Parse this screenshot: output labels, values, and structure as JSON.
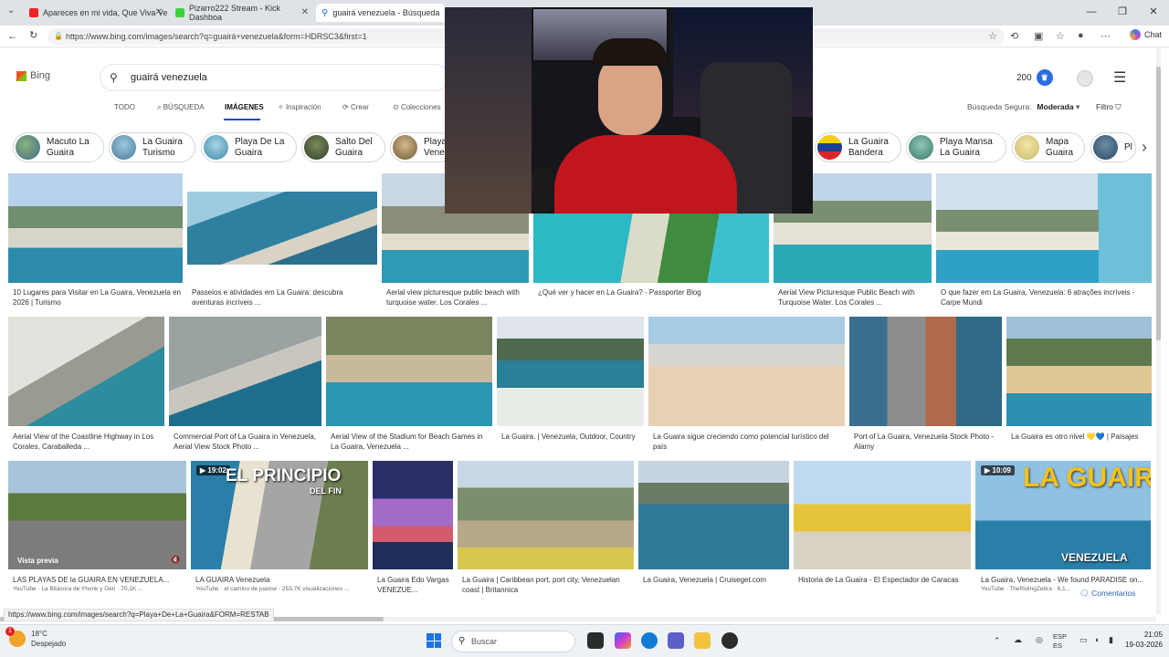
{
  "browser": {
    "tabs": [
      {
        "title": "Apareces en mi vida, Que Viva Ve",
        "color": "#e22"
      },
      {
        "title": "Pizarro222 Stream - Kick Dashboa",
        "color": "#3ad33a"
      },
      {
        "title": "guairá venezuela - Búsqueda",
        "color": "#2d6de0"
      }
    ],
    "url": "https://www.bing.com/images/search?q=guairá+venezuela&form=HDRSC3&first=1",
    "chat_label": "Chat",
    "status_url": "https://www.bing.com/images/search?q=Playa+De+La+Guaira&FORM=RESTAB"
  },
  "bing": {
    "logo_text": "Bing",
    "query": "guairá venezuela",
    "rewards_points": "200",
    "nav_tabs": [
      "TODO",
      "BÚSQUEDA",
      "IMÁGENES",
      "Inspiración",
      "Crear",
      "Colecciones"
    ],
    "safe_search_label": "Búsqueda Segura:",
    "safe_search_value": "Moderada",
    "filter_label": "Filtro",
    "chips": [
      "Macuto La\nGuaira",
      "La Guaira\nTurismo",
      "Playa De La\nGuaira",
      "Salto Del\nGuaira",
      "Playa\nVene",
      "La Guaira\nBandera",
      "Playa Mansa\nLa Guaira",
      "Mapa\nGuaira",
      "Pl"
    ],
    "feedback_label": "Comentarios"
  },
  "results": {
    "row1": [
      {
        "caption": "10 Lugares para Visitar en La Guaira, Venezuela en 2026 | Turismo"
      },
      {
        "caption": "Passeios e atividades em La Guaira: descubra aventuras incríveis ..."
      },
      {
        "caption": "Aerial view picturesque public beach with turquoise water. Los Corales ..."
      },
      {
        "caption": "¿Qué ver y hacer en La Guaira? - Passporter Blog"
      },
      {
        "caption": "Aerial View Picturesque Public Beach with Turquoise Water. Los Corales ..."
      },
      {
        "caption": "O que fazer em La Guaira, Venezuela: 6 atrações incríveis - Carpe Mundi"
      }
    ],
    "row2": [
      {
        "caption": "Aerial View of the Coastline Highway in Los Corales, Caraballeda ..."
      },
      {
        "caption": "Commercial Port of La Guaira in Venezuela, Aerial View Stock Photo ..."
      },
      {
        "caption": "Aerial View of the Stadium for Beach Games in La Guaira, Venezuela ..."
      },
      {
        "caption": "La Guaira. | Venezuela, Outdoor, Country"
      },
      {
        "caption": "La Guaira sigue creciendo como potencial turístico del país"
      },
      {
        "caption": "Port of La Guaira, Venezuela Stock Photo - Alamy"
      },
      {
        "caption": "La Guaira es otro nivel 💛💙 | Paisajes"
      }
    ],
    "row3": [
      {
        "caption": "LAS PLAYAS DE la GUAIRA EN VENEZUELA...",
        "source": "YouTube · La Bitácora de Yhonk y Geri · 70,1K ...",
        "badge": "Vista previa"
      },
      {
        "caption": "LA GUAIRA Venezuela",
        "source": "YouTube · el camino de juanse · 253,7K visualizaciones ...",
        "duration": "19:02",
        "overlay_text": "EL PRINCIPIO",
        "overlay_sub": "DEL FIN"
      },
      {
        "caption": "La Guaira Edo Vargas VENEZUE..."
      },
      {
        "caption": "La Guaira | Caribbean port, port city, Venezuelan coast | Britannica"
      },
      {
        "caption": "La Guaira, Venezuela | Cruiseget.com"
      },
      {
        "caption": "Historia de La Guaira - El Espectador de Caracas"
      },
      {
        "caption": "La Guaira, Venezuela - We found PARADISE on...",
        "source": "YouTube · TheRidingZebra · 6,1...",
        "duration": "10:09",
        "overlay_text": "LA GUAIR",
        "overlay_sub": "VENEZUELA"
      }
    ]
  },
  "taskbar": {
    "weather_temp": "18°C",
    "weather_desc": "Despejado",
    "weather_badge": "1",
    "search_placeholder": "Buscar",
    "lang1": "ESP",
    "lang2": "ES",
    "time": "21:05",
    "date": "19-03-2026"
  }
}
